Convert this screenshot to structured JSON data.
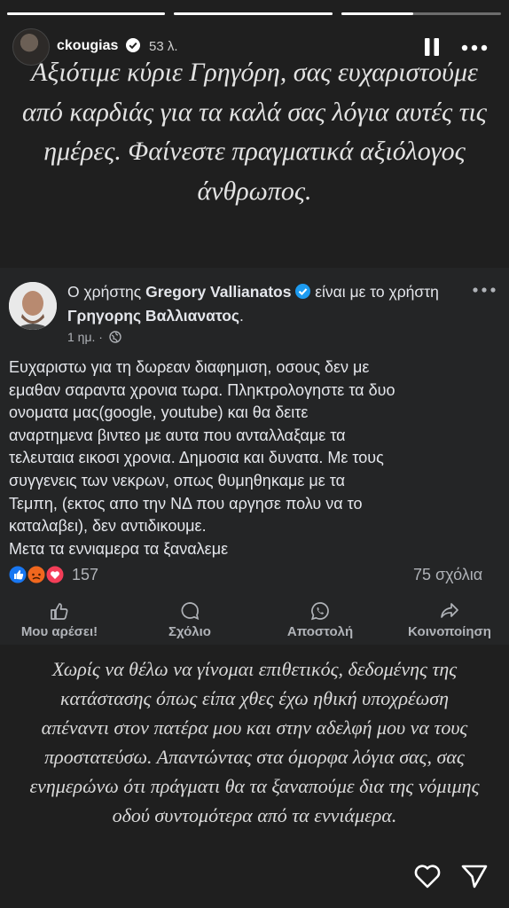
{
  "story": {
    "progress": [
      1.0,
      1.0,
      0.45
    ],
    "username": "ckougias",
    "time_ago": "53 λ.",
    "top_text": "Αξιότιμε κύριε Γρηγόρη, σας ευχαριστούμε από καρδιάς για τα καλά σας λόγια αυτές τις ημέρες. Φαίνεστε πραγματικά αξιόλογος άνθρωπος.",
    "bottom_text": "Χωρίς να θέλω να γίνομαι επιθετικός, δεδομένης της κατάστασης όπως είπα χθες έχω ηθική υποχρέωση απέναντι στον πατέρα μου και στην αδελφή μου να τους προστατεύσω. Απαντώντας στα όμορφα λόγια σας, σας ενημερώνω ότι πράγματι θα τα ξαναπούμε δια της νόμιμης οδού συντομότερα από τα εννιάμερα."
  },
  "post": {
    "prefix": "Ο χρήστης ",
    "author": "Gregory Vallianatos",
    "middle": " είναι με το χρήστη ",
    "with_user": "Γρηγορης Βαλλιανατος",
    "suffix": ".",
    "time": "1 ημ. ·",
    "body_lines": [
      "Ευχαριστω για τη δωρεαν διαφημιση, οσους δεν με",
      "εμαθαν σαραντα χρονια τωρα. Πληκτρολογηστε τα δυο",
      "ονοματα μας(google, youtube) και θα δειτε",
      "αναρτημενα βιντεο με αυτα που ανταλλαξαμε τα",
      "τελευταια εικοσι χρονια. Δημοσια και δυνατα. Με τους",
      "συγγενεις των νεκρων, οπως θυμηθηκαμε με τα",
      "Τεμπη, (εκτος απο την ΝΔ που αργησε πολυ να το",
      "καταλαβει), δεν αντιδικουμε.",
      "Μετα τα εννιαμερα τα ξαναλεμε"
    ],
    "reaction_count": "157",
    "comments": "75 σχόλια",
    "actions": [
      {
        "icon": "thumbs-up-icon",
        "label": "Μου αρέσει!"
      },
      {
        "icon": "comment-icon",
        "label": "Σχόλιο"
      },
      {
        "icon": "whatsapp-icon",
        "label": "Αποστολή"
      },
      {
        "icon": "share-icon",
        "label": "Κοινοποίηση"
      }
    ]
  },
  "colors": {
    "background": "#1f1f1f",
    "card": "#242526",
    "verified": "#1d9bf0",
    "like": "#1877f2",
    "angry": "#f0671e",
    "love": "#f33e58"
  }
}
